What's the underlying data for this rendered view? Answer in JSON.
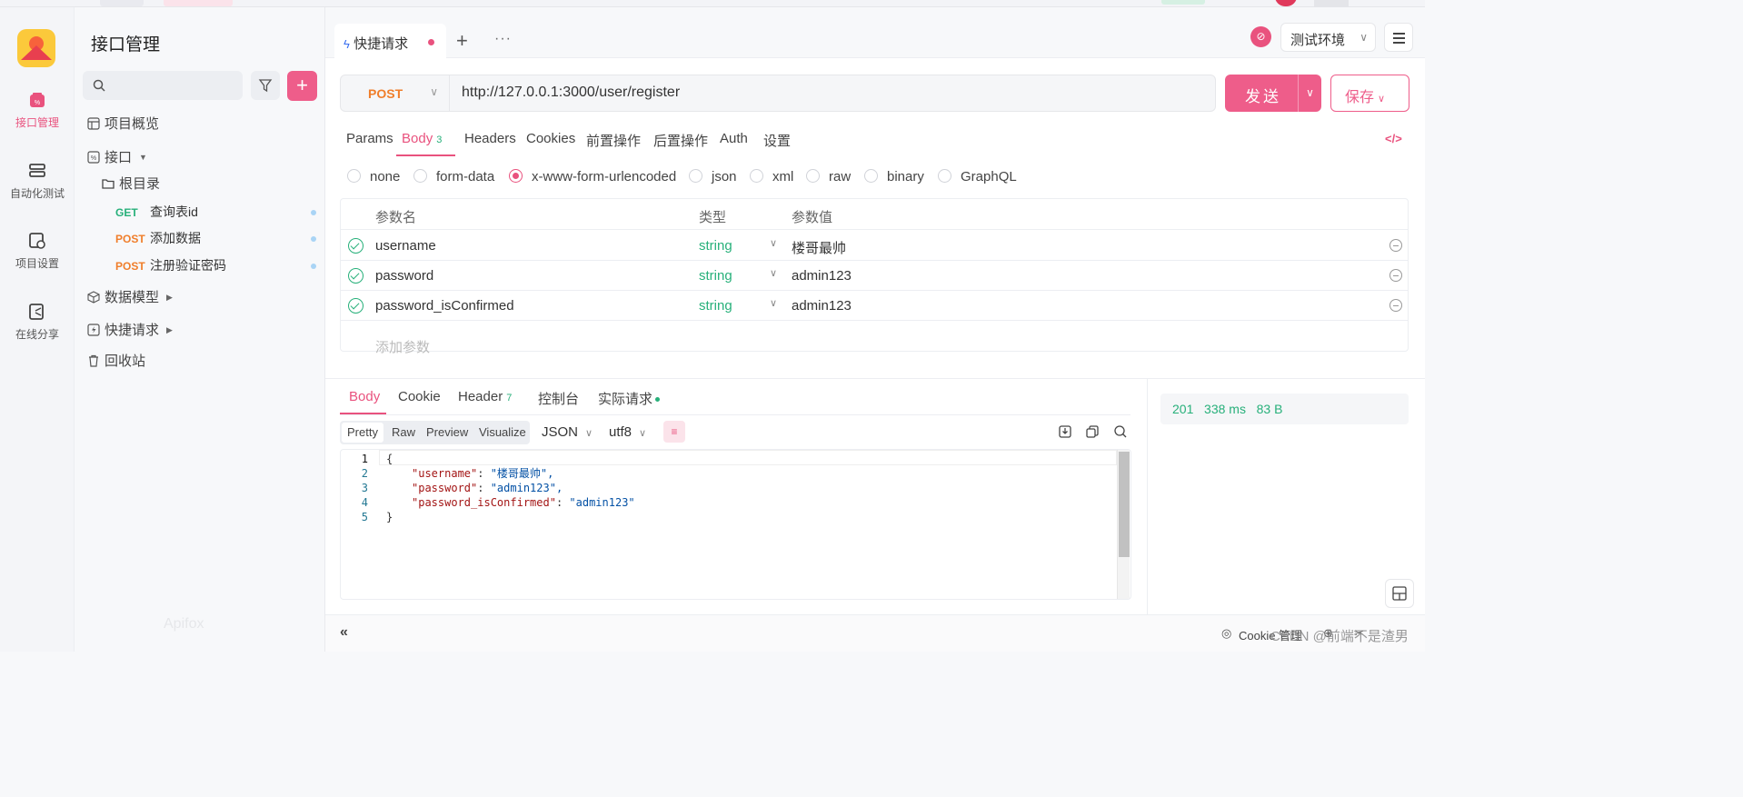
{
  "app": {
    "title": "接口管理"
  },
  "nav": [
    {
      "label": "接口管理",
      "icon": "api-icon",
      "active": true
    },
    {
      "label": "自动化测试",
      "icon": "automation-icon"
    },
    {
      "label": "项目设置",
      "icon": "project-settings-icon"
    },
    {
      "label": "在线分享",
      "icon": "share-icon"
    }
  ],
  "sidebar": {
    "overview": "项目概览",
    "interfaces": "接口",
    "root": "根目录",
    "apis": [
      {
        "method": "GET",
        "name": "查询表id"
      },
      {
        "method": "POST",
        "name": "添加数据"
      },
      {
        "method": "POST",
        "name": "注册验证密码"
      }
    ],
    "models": "数据模型",
    "quick": "快捷请求",
    "trash": "回收站",
    "watermark": "Apifox"
  },
  "tabs": {
    "active_label": "快捷请求",
    "add": "+",
    "more": "···"
  },
  "env": {
    "label": "测试环境"
  },
  "request": {
    "method": "POST",
    "url": "http://127.0.0.1:3000/user/register",
    "send": "发送",
    "save": "保存"
  },
  "req_tabs": {
    "params": "Params",
    "body": "Body",
    "body_count": "3",
    "headers": "Headers",
    "cookies": "Cookies",
    "pre": "前置操作",
    "post": "后置操作",
    "auth": "Auth",
    "settings": "设置"
  },
  "body_types": {
    "none": "none",
    "form_data": "form-data",
    "urlencoded": "x-www-form-urlencoded",
    "json": "json",
    "xml": "xml",
    "raw": "raw",
    "binary": "binary",
    "graphql": "GraphQL",
    "selected": "x-www-form-urlencoded"
  },
  "params_table": {
    "headers": {
      "name": "参数名",
      "type": "类型",
      "value": "参数值"
    },
    "rows": [
      {
        "name": "username",
        "type": "string",
        "value": "楼哥最帅"
      },
      {
        "name": "password",
        "type": "string",
        "value": "admin123"
      },
      {
        "name": "password_isConfirmed",
        "type": "string",
        "value": "admin123"
      }
    ],
    "add_placeholder": "添加参数"
  },
  "response": {
    "tabs": {
      "body": "Body",
      "cookie": "Cookie",
      "header": "Header",
      "header_count": "7",
      "console": "控制台",
      "actual": "实际请求"
    },
    "formats": {
      "pretty": "Pretty",
      "raw": "Raw",
      "preview": "Preview",
      "visualize": "Visualize"
    },
    "lang": "JSON",
    "encoding": "utf8",
    "lines": [
      {
        "n": "1",
        "k": "",
        "v": "{"
      },
      {
        "n": "2",
        "k": "\"username\"",
        "v": "\"楼哥最帅\","
      },
      {
        "n": "3",
        "k": "\"password\"",
        "v": "\"admin123\","
      },
      {
        "n": "4",
        "k": "\"password_isConfirmed\"",
        "v": "\"admin123\""
      },
      {
        "n": "5",
        "k": "",
        "v": "}"
      }
    ],
    "status": "201",
    "time": "338 ms",
    "size": "83 B"
  },
  "footer": {
    "cookie_mgr": "Cookie 管理",
    "collapse": "«",
    "csdn": "CSDN @前端不是渣男"
  }
}
